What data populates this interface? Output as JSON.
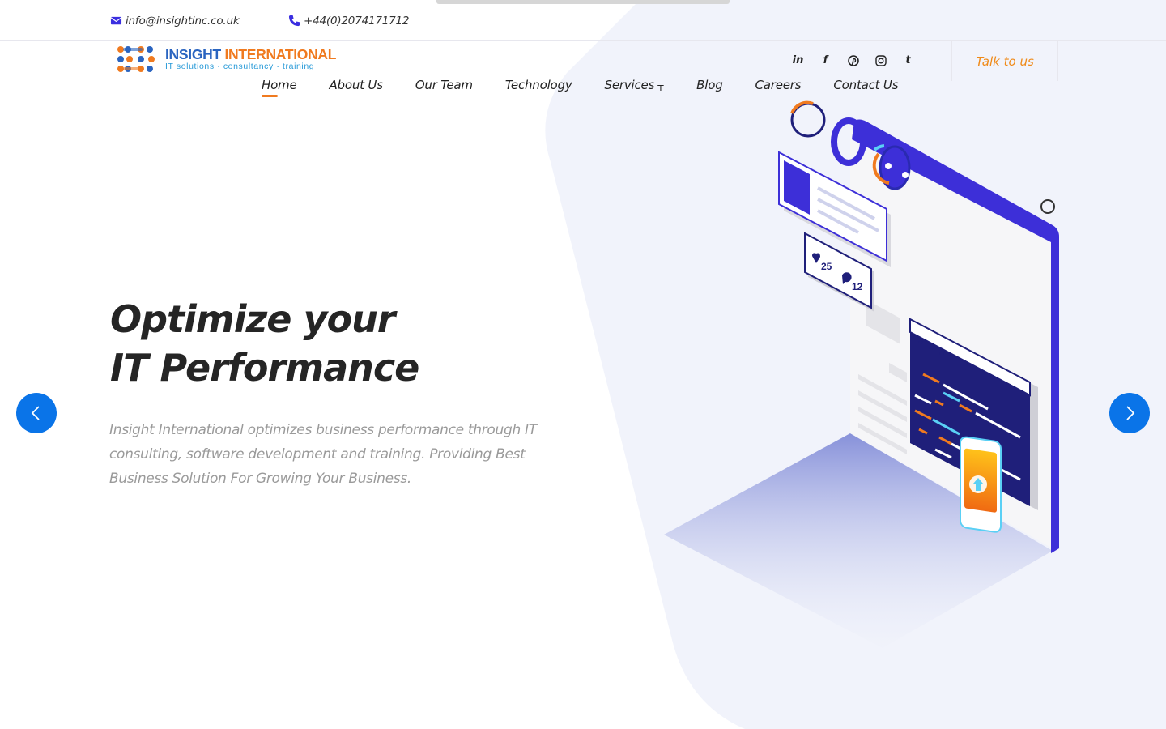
{
  "topbar": {
    "email": "info@insightinc.co.uk",
    "phone": "+44(0)2074171712",
    "email_icon": "envelope-icon",
    "phone_icon": "phone-icon"
  },
  "logo": {
    "title_part1": "INSIGHT",
    "title_part2": "INTERNATIONAL",
    "subtitle": "IT solutions · consultancy · training"
  },
  "social": [
    {
      "name": "linkedin-icon",
      "glyph": "in"
    },
    {
      "name": "facebook-icon",
      "glyph": "f"
    },
    {
      "name": "pinterest-icon",
      "glyph": "℗"
    },
    {
      "name": "instagram-icon",
      "glyph": "◎"
    },
    {
      "name": "tumblr-icon",
      "glyph": "t"
    }
  ],
  "header": {
    "cta_label": "Talk to us"
  },
  "nav": {
    "items": [
      {
        "label": "Home",
        "active": true
      },
      {
        "label": "About Us"
      },
      {
        "label": "Our Team"
      },
      {
        "label": "Technology"
      },
      {
        "label": "Services",
        "dropdown": true
      },
      {
        "label": "Blog"
      },
      {
        "label": "Careers"
      },
      {
        "label": "Contact Us"
      }
    ],
    "dropdown_caret": "⊤"
  },
  "hero": {
    "title_line1": "Optimize your",
    "title_line2": "IT Performance",
    "description": "Insight International optimizes business performance through IT consulting, software development and training. Providing Best Business Solution For Growing Your Business.",
    "illustration": {
      "likes": "25",
      "comments": "12"
    }
  },
  "slider": {
    "prev_icon": "chevron-left-icon",
    "next_icon": "chevron-right-icon"
  },
  "colors": {
    "accent_orange": "#f07a1f",
    "accent_blue": "#0a74e8",
    "illustration_purple": "#3d2fd8",
    "logo_blue": "#2a64c0"
  }
}
